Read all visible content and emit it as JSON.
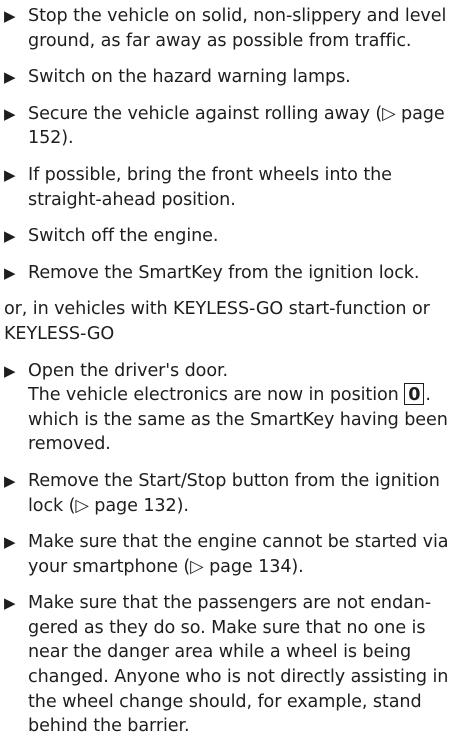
{
  "bullet_glyph": "▶",
  "steps": [
    {
      "text": "Stop the vehicle on solid, non-slippery and level ground, as far away as possible from traffic."
    },
    {
      "text": "Switch on the hazard warning lamps."
    },
    {
      "text": "Secure the vehicle against rolling away (▷ page 152)."
    },
    {
      "text": "If possible, bring the front wheels into the straight-ahead position."
    },
    {
      "text": "Switch off the engine."
    },
    {
      "text": "Remove the SmartKey from the ignition lock."
    }
  ],
  "alternative": "or, in vehicles with KEYLESS-GO start-function or KEYLESS-GO",
  "door_step": {
    "text": "Open the driver's door.",
    "note_before": "The vehicle electronics are now in position",
    "key_position": "0",
    "note_after": ". which is the same as the SmartKey having been removed."
  },
  "steps_after": [
    {
      "text": "Remove the Start/Stop button from the igni­tion lock (▷ page 132)."
    },
    {
      "text": "Make sure that the engine cannot be started via your smartphone (▷ page 134)."
    },
    {
      "text": "Make sure that the passengers are not endan­gered as they do so. Make sure that no one is near the danger area while a wheel is being changed. Anyone who is not directly assisting in the wheel change should, for example, stand behind the barrier."
    }
  ]
}
